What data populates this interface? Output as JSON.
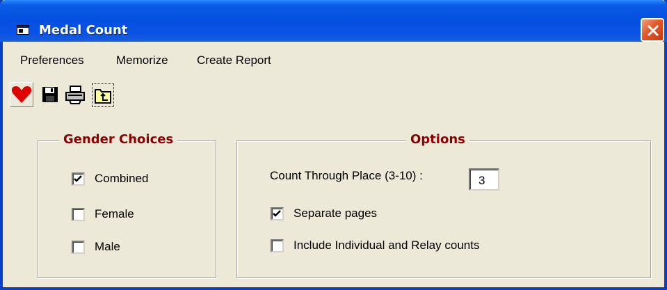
{
  "window": {
    "title": "Medal Count"
  },
  "menu": {
    "items": [
      {
        "label": "Preferences"
      },
      {
        "label": "Memorize"
      },
      {
        "label": "Create Report"
      }
    ]
  },
  "toolbar": {
    "buttons": [
      {
        "icon": "heart-icon"
      },
      {
        "icon": "floppy-disk-icon"
      },
      {
        "icon": "printer-icon"
      },
      {
        "icon": "up-folder-icon"
      }
    ]
  },
  "gender": {
    "legend": "Gender Choices",
    "options": [
      {
        "label": "Combined",
        "checked": true
      },
      {
        "label": "Female",
        "checked": false
      },
      {
        "label": "Male",
        "checked": false
      }
    ]
  },
  "options": {
    "legend": "Options",
    "count_through_label": "Count Through Place (3-10) :",
    "count_through_value": "3",
    "checks": [
      {
        "label": "Separate pages",
        "checked": true
      },
      {
        "label": "Include Individual and Relay counts",
        "checked": false
      }
    ]
  },
  "colors": {
    "title_bar": "#0550E0",
    "legend_text": "#8B0000",
    "window_bg": "#ECE9D8",
    "close_button": "#E2572B"
  }
}
